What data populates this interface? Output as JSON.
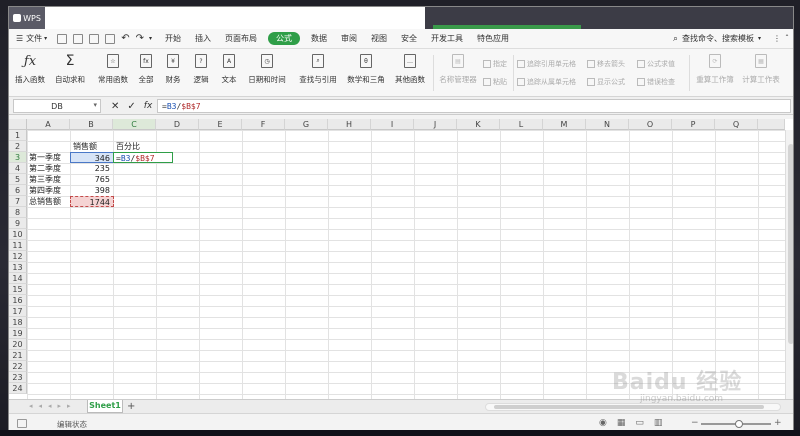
{
  "app": {
    "title": "WPS"
  },
  "menu": {
    "file": "文件",
    "items": [
      "开始",
      "插入",
      "页面布局",
      "公式",
      "数据",
      "审阅",
      "视图",
      "安全",
      "开发工具",
      "特色应用"
    ],
    "active": "公式",
    "search": "查找命令、搜索模板"
  },
  "ribbon": {
    "insert_function": "插入函数",
    "autosum": "自动求和",
    "common_functions": "常用函数",
    "all": "全部",
    "finance": "财务",
    "logic": "逻辑",
    "text": "文本",
    "datetime": "日期和时间",
    "lookup": "查找与引用",
    "math_trig": "数学和三角",
    "other_functions": "其他函数",
    "name_manager": "名称管理器",
    "specify": "指定",
    "paste": "粘贴",
    "trace_precedents": "追踪引用单元格",
    "trace_dependents": "追踪从属单元格",
    "remove_arrows": "移去箭头",
    "show_formulas": "显示公式",
    "evaluate_formula": "公式求值",
    "error_check": "错误检查",
    "recalc_workbook": "重算工作簿",
    "calc_sheet": "计算工作表"
  },
  "formula_bar": {
    "name_box": "DB",
    "formula_prefix": "=",
    "formula_ref1": "B3",
    "formula_sep": "/",
    "formula_ref2": "$B$7",
    "fx": "fx"
  },
  "columns": [
    "A",
    "B",
    "C",
    "D",
    "E",
    "F",
    "G",
    "H",
    "I",
    "J",
    "K",
    "L",
    "M",
    "N",
    "O",
    "P",
    "Q"
  ],
  "rows": [
    "1",
    "2",
    "3",
    "4",
    "5",
    "6",
    "7",
    "8",
    "9",
    "10",
    "11",
    "12",
    "13",
    "14",
    "15",
    "16",
    "17",
    "18",
    "19",
    "20",
    "21",
    "22",
    "23",
    "24"
  ],
  "cells": {
    "B2": "销售额",
    "C2": "百分比",
    "A3": "第一季度",
    "B3": "346",
    "C3": "=B3/$B$7",
    "A4": "第二季度",
    "B4": "235",
    "A5": "第三季度",
    "B5": "765",
    "A6": "第四季度",
    "B6": "398",
    "A7": "总销售额",
    "B7": "1744"
  },
  "sheet": {
    "tab": "Sheet1",
    "add": "+"
  },
  "status": {
    "mode": "编辑状态"
  },
  "watermark": {
    "brand": "Baidu 经验",
    "url": "jingyan.baidu.com"
  },
  "colors": {
    "accent": "#2f9e48",
    "ref1": "#1a4fb0",
    "ref2": "#b02b2b"
  }
}
